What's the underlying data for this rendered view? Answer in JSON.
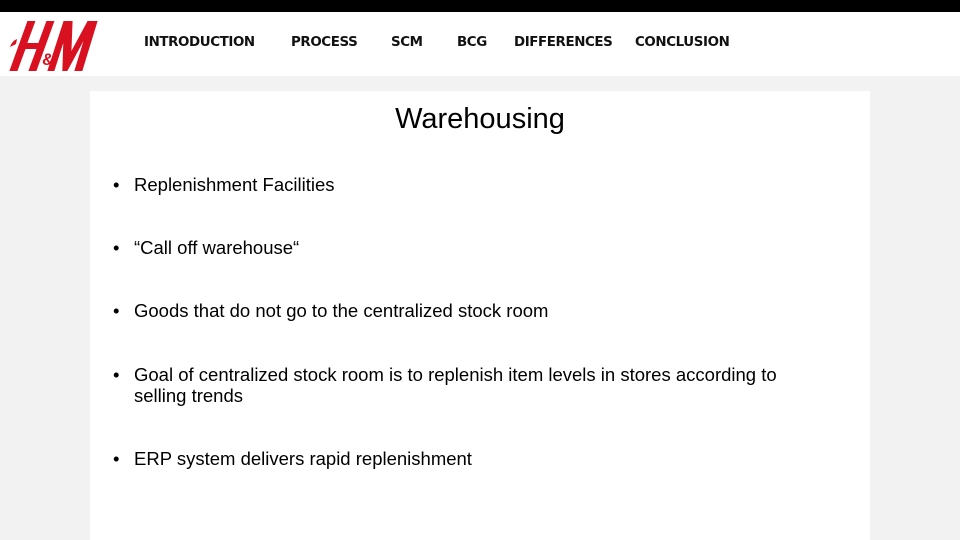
{
  "brand": {
    "logo_text": "H&M",
    "logo_color": "#d8101f"
  },
  "nav": {
    "items": [
      {
        "label": "INTRODUCTION"
      },
      {
        "label": "PROCESS"
      },
      {
        "label": "SCM"
      },
      {
        "label": "BCG"
      },
      {
        "label": "DIFFERENCES"
      },
      {
        "label": "CONCLUSION"
      }
    ]
  },
  "slide": {
    "title": "Warehousing",
    "bullet_glyph": "•",
    "bullets": [
      {
        "text": "Replenishment Facilities"
      },
      {
        "text": "“Call off warehouse“"
      },
      {
        "text": "Goods that do not go to the centralized stock room"
      },
      {
        "text": "Goal of centralized stock room is to replenish item levels in stores according to selling trends"
      },
      {
        "text": "ERP system delivers rapid replenishment"
      }
    ]
  }
}
